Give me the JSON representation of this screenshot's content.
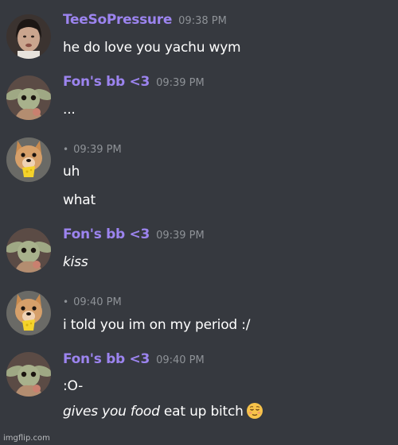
{
  "messages": [
    {
      "author": "TeeSoPressure",
      "time": "09:38 PM",
      "avatar": "dark-haired-person-avatar",
      "lines": [
        "he do love you yachu wym"
      ]
    },
    {
      "author": "Fon's bb <3",
      "time": "09:39 PM",
      "avatar": "baby-yoda-avatar",
      "lines": [
        "..."
      ]
    },
    {
      "author": "",
      "time": "09:39 PM",
      "avatar": "dog-holding-cheese-avatar",
      "lines": [
        "uh",
        "what"
      ]
    },
    {
      "author": "Fon's bb <3",
      "time": "09:39 PM",
      "avatar": "baby-yoda-avatar",
      "lines": [
        "kiss"
      ]
    },
    {
      "author": "",
      "time": "09:40 PM",
      "avatar": "dog-holding-cheese-avatar",
      "lines": [
        "i told you im on my period :/"
      ]
    },
    {
      "author": "Fon's bb <3",
      "time": "09:40 PM",
      "avatar": "baby-yoda-avatar",
      "line1": ":O-",
      "line2_italic": "gives you food",
      "line2_rest": " eat up bitch",
      "line2_emoji": "relieved-face-emoji"
    }
  ],
  "dot": "•",
  "watermark": "imgflip.com",
  "colors": {
    "background": "#36393f",
    "username": "#9c84ef",
    "timestamp": "#8e9297",
    "message_text": "#ffffff"
  }
}
